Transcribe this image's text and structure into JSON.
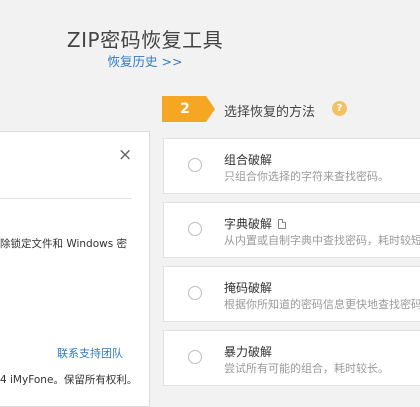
{
  "header": {
    "app_title": "ZIP密码恢复工具",
    "history_link": "恢复历史 >>"
  },
  "dialog": {
    "close": "×",
    "body_text": "除锁定文件和 Windows 密",
    "support_link": "联系支持团队",
    "copyright": "4 iMyFone。保留所有权利。"
  },
  "step": {
    "number": "2",
    "title": "选择恢复的方法",
    "help": "?",
    "badge_color": "#f5a623"
  },
  "options": [
    {
      "title": "组合破解",
      "desc": "只组合你选择的字符来查找密码。",
      "selected": false
    },
    {
      "title": "字典破解",
      "desc": "从内置或自制字典中查找密码，耗时较短",
      "selected": false,
      "icon": "document-icon"
    },
    {
      "title": "掩码破解",
      "desc": "根据你所知道的密码信息更快地查找密码",
      "selected": false
    },
    {
      "title": "暴力破解",
      "desc": "尝试所有可能的组合，耗时较长。",
      "selected": false
    }
  ]
}
